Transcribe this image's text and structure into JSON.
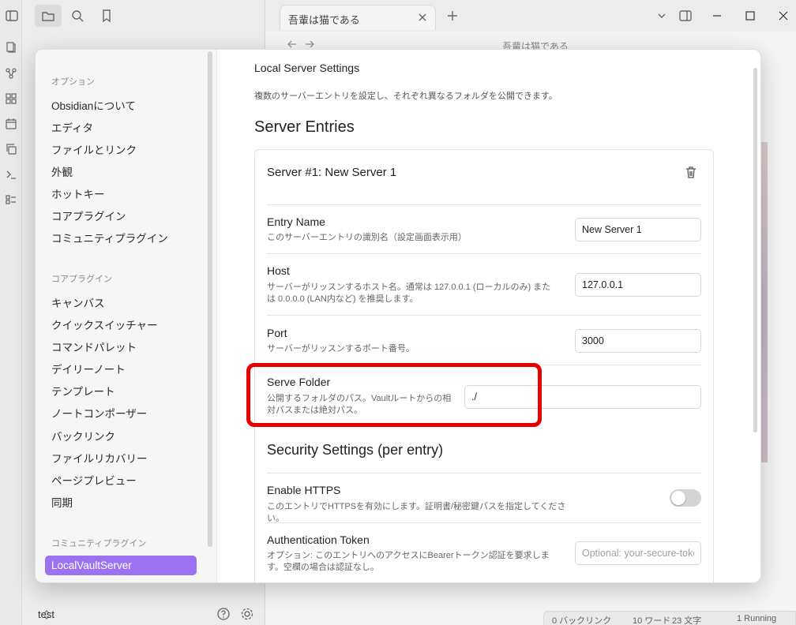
{
  "app": {
    "tab_title": "吾輩は猫である",
    "note_title": "吾輩は猫である",
    "vault_name": "test",
    "status": {
      "backlinks": "0 バックリンク",
      "words": "10 ワード",
      "chars": "23 文字",
      "running": "1 Running"
    }
  },
  "sidebar": {
    "options_head": "オプション",
    "options": [
      "Obsidianについて",
      "エディタ",
      "ファイルとリンク",
      "外観",
      "ホットキー",
      "コアプラグイン",
      "コミュニティプラグイン"
    ],
    "core_head": "コアプラグイン",
    "core": [
      "キャンバス",
      "クイックスイッチャー",
      "コマンドパレット",
      "デイリーノート",
      "テンプレート",
      "ノートコンポーザー",
      "バックリンク",
      "ファイルリカバリー",
      "ページプレビュー",
      "同期"
    ],
    "community_head": "コミュニティプラグイン",
    "community": [
      "LocalVaultServer"
    ]
  },
  "settings": {
    "section_title": "Local Server Settings",
    "section_desc": "複数のサーバーエントリを設定し、それぞれ異なるフォルダを公開できます。",
    "entries_heading": "Server Entries",
    "server_title": "Server #1: New Server 1",
    "entry_name": {
      "label": "Entry Name",
      "desc": "このサーバーエントリの識別名（設定画面表示用）",
      "value": "New Server 1"
    },
    "host": {
      "label": "Host",
      "desc": "サーバーがリッスンするホスト名。通常は 127.0.0.1 (ローカルのみ) または 0.0.0.0 (LAN内など) を推奨します。",
      "value": "127.0.0.1"
    },
    "port": {
      "label": "Port",
      "desc": "サーバーがリッスンするポート番号。",
      "value": "3000"
    },
    "serve_folder": {
      "label": "Serve Folder",
      "desc": "公開するフォルダのパス。Vaultルートからの相対パスまたは絶対パス。",
      "value": "./"
    },
    "security_heading": "Security Settings (per entry)",
    "https": {
      "label": "Enable HTTPS",
      "desc": "このエントリでHTTPSを有効にします。証明書/秘密鍵パスを指定してください。",
      "enabled": false
    },
    "auth": {
      "label": "Authentication Token",
      "desc": "オプション: このエントリへのアクセスにBearerトークン認証を要求します。空欄の場合は認証なし。",
      "placeholder": "Optional: your-secure-token"
    }
  },
  "colors": {
    "accent": "#9b72f2",
    "highlight": "#e60000"
  }
}
